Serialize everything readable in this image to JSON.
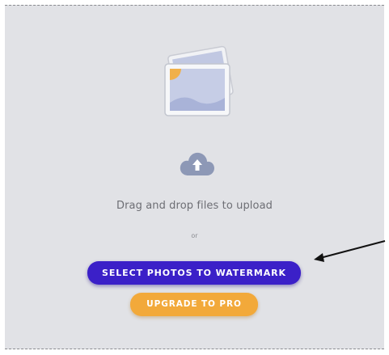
{
  "upload": {
    "image_icon": "photo-stack-icon",
    "cloud_icon": "cloud-upload-icon",
    "drag_text": "Drag and drop files to upload",
    "or_text": "or"
  },
  "buttons": {
    "select_label": "SELECT PHOTOS TO WATERMARK",
    "upgrade_label": "UPGRADE TO PRO"
  },
  "annotation": {
    "arrow_icon": "pointer-arrow-icon"
  },
  "colors": {
    "dropzone_bg": "#e1e2e6",
    "select_button": "#3b20c8",
    "upgrade_button": "#f2a93a"
  }
}
